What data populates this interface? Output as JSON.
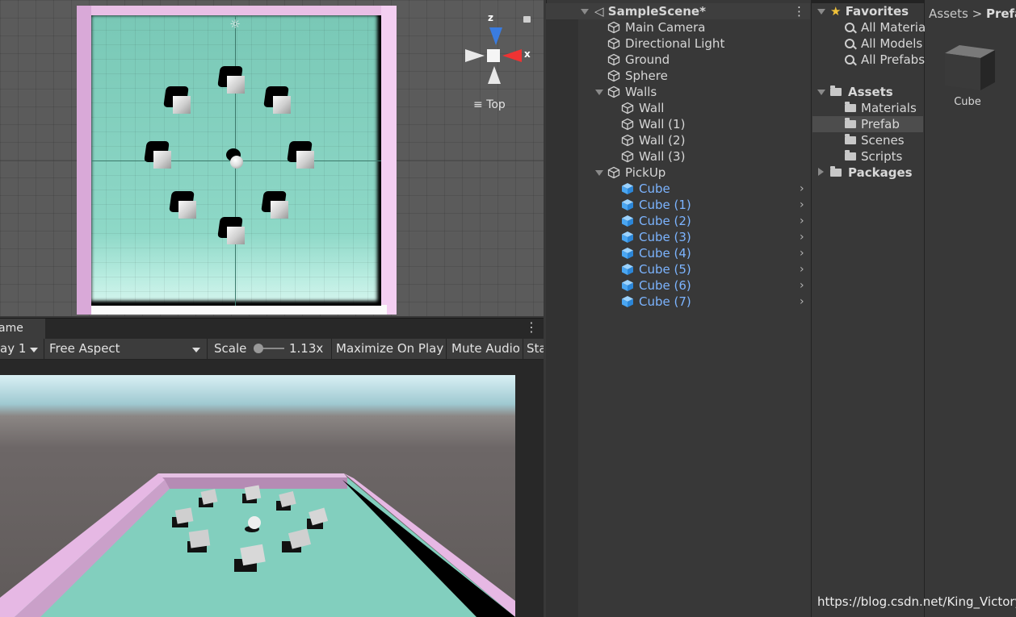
{
  "scene": {
    "view_label": "Top",
    "axis_x": "x",
    "axis_z": "z",
    "pickup_count": 8
  },
  "game": {
    "tab_label": "ame",
    "display": "ay 1",
    "aspect": "Free Aspect",
    "scale_label": "Scale",
    "scale_value": "1.13x",
    "maximize_label": "Maximize On Play",
    "mute_label": "Mute Audio",
    "stats_label": "Sta"
  },
  "hierarchy": {
    "scene_name": "SampleScene*",
    "items": [
      {
        "label": "Main Camera"
      },
      {
        "label": "Directional Light"
      },
      {
        "label": "Ground"
      },
      {
        "label": "Sphere"
      },
      {
        "label": "Walls"
      },
      {
        "label": "Wall"
      },
      {
        "label": "Wall (1)"
      },
      {
        "label": "Wall (2)"
      },
      {
        "label": "Wall (3)"
      },
      {
        "label": "PickUp"
      },
      {
        "label": "Cube"
      },
      {
        "label": "Cube (1)"
      },
      {
        "label": "Cube (2)"
      },
      {
        "label": "Cube (3)"
      },
      {
        "label": "Cube (4)"
      },
      {
        "label": "Cube (5)"
      },
      {
        "label": "Cube (6)"
      },
      {
        "label": "Cube (7)"
      }
    ]
  },
  "project": {
    "favorites_label": "Favorites",
    "favorites": [
      "All Materia",
      "All Models",
      "All Prefabs"
    ],
    "assets_label": "Assets",
    "folders": [
      "Materials",
      "Prefab",
      "Scenes",
      "Scripts"
    ],
    "packages_label": "Packages",
    "breadcrumb_root": "Assets",
    "breadcrumb_sep": ">",
    "breadcrumb_current": "Prefa",
    "asset_name": "Cube"
  },
  "watermark": "https://blog.csdn.net/King_Victory",
  "colors": {
    "prefab_text": "#7cb4ff",
    "ground": "#8ed8c7",
    "wall": "#e9bfe6"
  }
}
